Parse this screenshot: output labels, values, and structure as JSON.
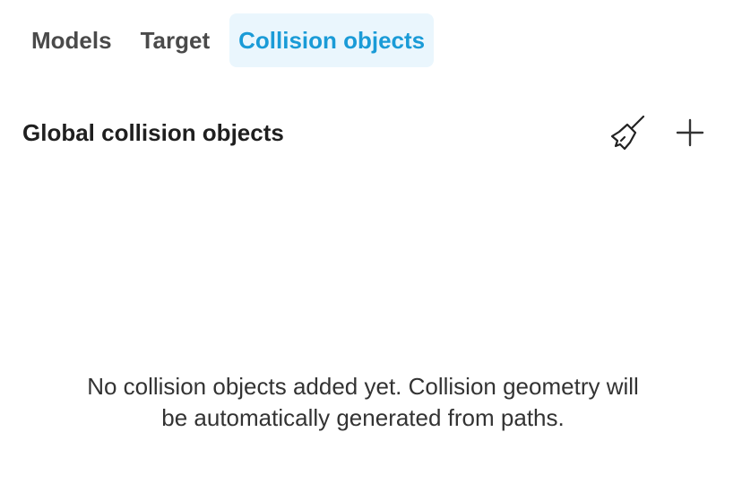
{
  "tabs": [
    {
      "label": "Models",
      "active": false
    },
    {
      "label": "Target",
      "active": false
    },
    {
      "label": "Collision objects",
      "active": true
    }
  ],
  "section": {
    "title": "Global collision objects",
    "actions": [
      {
        "icon": "broom-icon"
      },
      {
        "icon": "plus-icon"
      }
    ]
  },
  "empty_state": {
    "line1": "No collision objects added yet. Collision geometry will",
    "line2": "be automatically generated from paths."
  },
  "colors": {
    "accent": "#1a9bd7",
    "active_tab_bg": "#eaf6fd",
    "text": "#333333"
  }
}
